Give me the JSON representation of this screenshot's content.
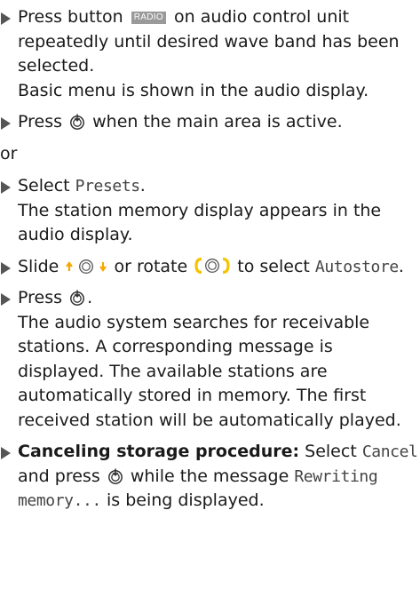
{
  "step1": {
    "pre": "Press button",
    "badge": "RADIO",
    "post": "on audio control unit repeatedly until desired wave band has been selected.",
    "result": "Basic menu is shown in the audio display."
  },
  "step2": {
    "pre": "Press",
    "post": "when the main area is active."
  },
  "or_label": "or",
  "step3": {
    "pre": "Select",
    "item": "Presets",
    "post": ".",
    "result": "The station memory display appears in the audio display."
  },
  "step4": {
    "pre": "Slide",
    "mid": "or rotate",
    "post": "to select",
    "item": "Autostore",
    "end": "."
  },
  "step5": {
    "pre": "Press",
    "post": ".",
    "result": "The audio system searches for receivable stations. A corresponding message is displayed. The available stations are automatically stored in memory. The first received station will be automatically played."
  },
  "step6": {
    "bold": "Canceling storage procedure:",
    "pre": "Select",
    "item": "Cancel",
    "mid": "and press",
    "post": "while the message",
    "message": "Rewriting memory...",
    "end": "is being displayed."
  },
  "icons": {
    "press": "controller-press-icon",
    "slide": "controller-slide-icon",
    "rotate": "controller-rotate-icon",
    "accent": "#f5c400"
  }
}
